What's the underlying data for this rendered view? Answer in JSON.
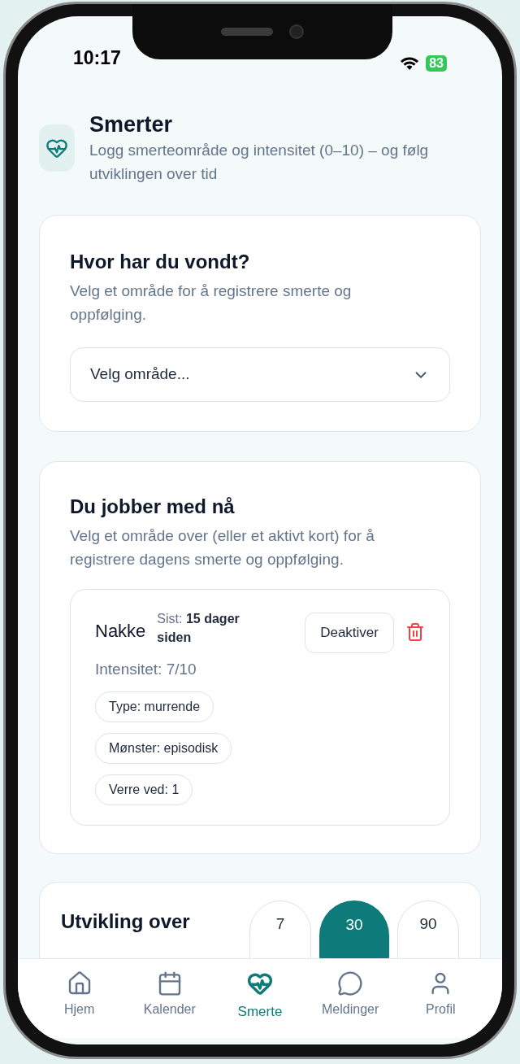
{
  "status_bar": {
    "time": "10:17",
    "battery": "83"
  },
  "header": {
    "title": "Smerter",
    "subtitle": "Logg smerteområde og intensitet (0–10) – og følg utviklingen over tid"
  },
  "area_card": {
    "title": "Hvor har du vondt?",
    "description": "Velg et område for å registrere smerte og oppfølging.",
    "select": {
      "placeholder": "Velg område..."
    }
  },
  "active_card": {
    "title": "Du jobber med nå",
    "description": "Velg et område over (eller et aktivt kort) for å registrere dagens smerte og oppfølging.",
    "items": [
      {
        "name": "Nakke",
        "last_label": "Sist:",
        "last_value": "15 dager siden",
        "intensity": "Intensitet: 7/10",
        "button": "Deaktiver",
        "tags": [
          "Type: murrende",
          "Mønster: episodisk",
          "Verre ved: 1"
        ]
      }
    ]
  },
  "trend_card": {
    "title": "Utvikling over",
    "ranges": [
      {
        "label": "7",
        "selected": false
      },
      {
        "label": "30",
        "selected": true
      },
      {
        "label": "90",
        "selected": false
      }
    ]
  },
  "nav": [
    {
      "label": "Hjem",
      "selected": false
    },
    {
      "label": "Kalender",
      "selected": false
    },
    {
      "label": "Smerte",
      "selected": true
    },
    {
      "label": "Meldinger",
      "selected": false
    },
    {
      "label": "Profil",
      "selected": false
    }
  ]
}
